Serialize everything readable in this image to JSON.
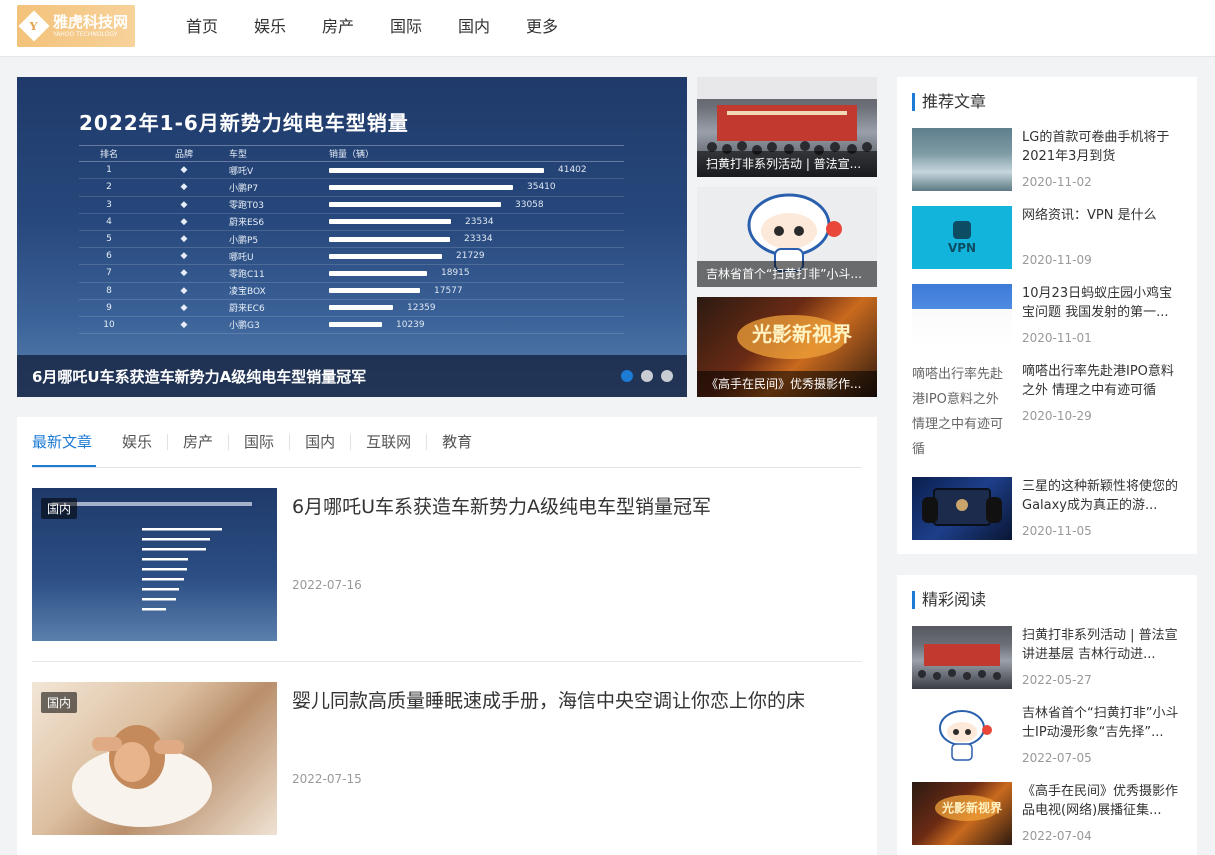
{
  "header": {
    "logo_name": "雅虎科技网",
    "logo_sub": "YAHOO TECHNOLOGY",
    "nav": [
      "首页",
      "娱乐",
      "房产",
      "国际",
      "国内",
      "更多"
    ]
  },
  "slider": {
    "headline": "2022年1-6月新势力纯电车型销量",
    "table_head": [
      "排名",
      "品牌",
      "车型",
      "销量（辆）"
    ],
    "rows": [
      {
        "rank": "1",
        "model": "哪吒V",
        "sales": 41402
      },
      {
        "rank": "2",
        "model": "小鹏P7",
        "sales": 35410
      },
      {
        "rank": "3",
        "model": "零跑T03",
        "sales": 33058
      },
      {
        "rank": "4",
        "model": "蔚来ES6",
        "sales": 23534
      },
      {
        "rank": "5",
        "model": "小鹏P5",
        "sales": 23334
      },
      {
        "rank": "6",
        "model": "哪吒U",
        "sales": 21729
      },
      {
        "rank": "7",
        "model": "零跑C11",
        "sales": 18915
      },
      {
        "rank": "8",
        "model": "凌宝BOX",
        "sales": 17577
      },
      {
        "rank": "9",
        "model": "蔚来EC6",
        "sales": 12359
      },
      {
        "rank": "10",
        "model": "小鹏G3",
        "sales": 10239
      }
    ],
    "caption": "6月哪吒U车系获造车新势力A级纯电车型销量冠军",
    "active_slide": 1,
    "slide_count": 3
  },
  "side_thumbs": [
    {
      "caption": "扫黄打非系列活动 | 普法宣..."
    },
    {
      "caption": "吉林省首个“扫黄打非”小斗..."
    },
    {
      "caption": "《高手在民间》优秀摄影作..."
    }
  ],
  "tabs": [
    "最新文章",
    "娱乐",
    "房产",
    "国际",
    "国内",
    "互联网",
    "教育"
  ],
  "articles": [
    {
      "badge": "国内",
      "title": "6月哪吒U车系获造车新势力A级纯电车型销量冠军",
      "date": "2022-07-16"
    },
    {
      "badge": "国内",
      "title": "婴儿同款高质量睡眠速成手册，海信中央空调让你恋上你的床",
      "date": "2022-07-15"
    }
  ],
  "recommended": {
    "title": "推荐文章",
    "items": [
      {
        "title": "LG的首款可卷曲手机将于2021年3月到货",
        "date": "2020-11-02"
      },
      {
        "title": "网络资讯：VPN 是什么",
        "date": "2020-11-09",
        "img_text": "VPN"
      },
      {
        "title": "10月23日蚂蚁庄园小鸡宝宝问题 我国发射的第一...",
        "date": "2020-11-01"
      },
      {
        "title": "嘀嗒出行率先赴港IPO意料之外 情理之中有迹可循",
        "date": "2020-10-29",
        "alt": "嘀嗒出行率先赴港IPO意料之外 情理之中有迹可循"
      },
      {
        "title": "三星的这种新颖性将使您的Galaxy成为真正的游...",
        "date": "2020-11-05"
      }
    ]
  },
  "featured": {
    "title": "精彩阅读",
    "items": [
      {
        "title": "扫黄打非系列活动 | 普法宣讲进基层 吉林行动进...",
        "date": "2022-05-27"
      },
      {
        "title": "吉林省首个“扫黄打非”小斗士IP动漫形象“吉先择”...",
        "date": "2022-07-05"
      },
      {
        "title": "《高手在民间》优秀摄影作品电视(网络)展播征集...",
        "date": "2022-07-04"
      }
    ]
  },
  "colors": {
    "accent": "#1d7ad5",
    "logo": "#f3c27a"
  }
}
